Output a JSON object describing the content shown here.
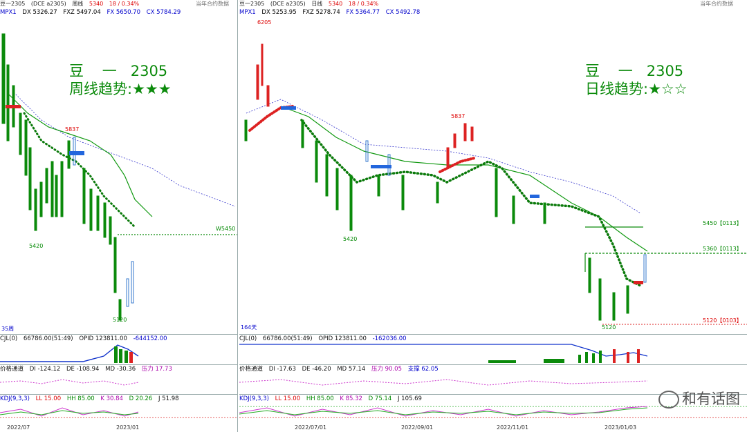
{
  "left": {
    "header": {
      "symbol": "豆一2305",
      "code": "(DCE a2305)",
      "period": "周线",
      "price": "5340",
      "change": "18 / 0.34%",
      "contract": "当年合约数据"
    },
    "indicator": {
      "name": "MPX1",
      "dx": "DX 5326.27",
      "fxz": "FXZ 5497.04",
      "fx": "FX 5650.70",
      "cx": "CX 5784.29"
    },
    "title_line1": "豆    一   2305",
    "title_line2": "周线趋势:★★★",
    "labels": {
      "high": "5837",
      "low1": "5420",
      "low2": "5120",
      "level": "W5450",
      "bars": "35周"
    },
    "cjl": {
      "name": "CJL(0)",
      "vol": "66786.00(51:49)",
      "opid": "OPID 123811.00",
      "delta": "-644152.00"
    },
    "channel": {
      "name": "价格通道",
      "di": "DI -124.12",
      "de": "DE -108.94",
      "md": "MD -30.36",
      "pressure": "压力 17.73"
    },
    "kdj": {
      "name": "KDJ(9,3,3)",
      "ll": "LL 15.00",
      "hh": "HH 85.00",
      "k": "K 30.84",
      "d": "D 20.26",
      "j": "J 51.98"
    },
    "x_labels": [
      "2022/07",
      "2023/01"
    ]
  },
  "right": {
    "header": {
      "symbol": "豆一2305",
      "code": "(DCE a2305)",
      "period": "日线",
      "price": "5340",
      "change": "18 / 0.34%",
      "contract": "当年合约数据"
    },
    "indicator": {
      "name": "MPX1",
      "dx": "DX 5253.95",
      "fxz": "FXZ 5278.74",
      "fx": "FX 5364.77",
      "cx": "CX 5492.78"
    },
    "title_line1": "豆    一   2305",
    "title_line2": "日线趋势:★☆☆",
    "labels": {
      "high1": "6205",
      "high2": "5837",
      "low1": "5420",
      "low2": "5120",
      "lvl1": "5450【0113】",
      "lvl2": "5360【0113】",
      "lvl3": "5120【0103】",
      "bars": "164天"
    },
    "cjl": {
      "name": "CJL(0)",
      "vol": "66786.00(51:49)",
      "opid": "OPID 123811.00",
      "delta": "-162036.00"
    },
    "channel": {
      "name": "价格通道",
      "di": "DI -17.63",
      "de": "DE -46.20",
      "md": "MD 57.14",
      "pressure": "压力 90.05",
      "support": "支撑 62.05"
    },
    "kdj": {
      "name": "KDJ(9,3,3)",
      "ll": "LL 15.00",
      "hh": "HH 85.00",
      "k": "K 85.32",
      "d": "D 75.14",
      "j": "J 105.69"
    },
    "x_labels": [
      "2022/07/01",
      "2022/09/01",
      "2022/11/01",
      "2023/01/03"
    ]
  },
  "watermark": "和有话图",
  "colors": {
    "green": "#0b8a0b",
    "red": "#dd0000",
    "blue": "#0033cc"
  }
}
